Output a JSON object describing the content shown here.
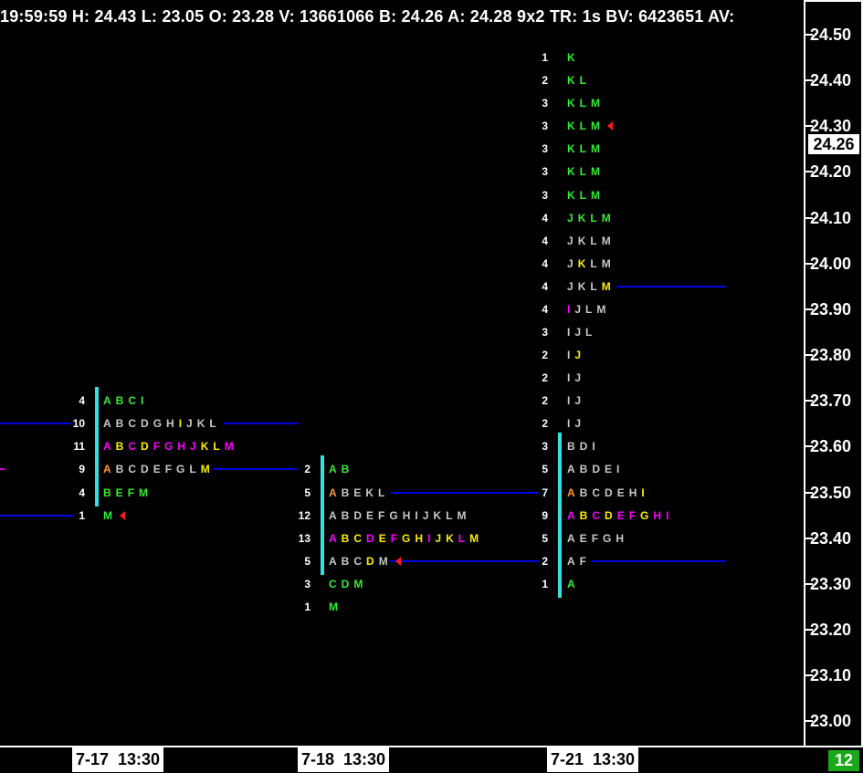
{
  "header": {
    "time": "19:59:59",
    "high_label": "H:",
    "high": "24.43",
    "low_label": "L:",
    "low": "23.05",
    "open_label": "O:",
    "open": "23.28",
    "volume_label": "V:",
    "volume": "13661066",
    "bid_label": "B:",
    "bid": "24.26",
    "ask_label": "A:",
    "ask": "24.28",
    "grid": "9x2",
    "tr_label": "TR:",
    "tr": "1s",
    "bv_label": "BV:",
    "bv": "6423651",
    "av_label": "AV:"
  },
  "colors": {
    "A": "#ff9933",
    "B": "#33ee33",
    "C": "#33ee33",
    "D": "#ffee00",
    "E": "#33ee33",
    "F": "#ff00ff",
    "G": "#ffee00",
    "H": "#ffee00",
    "I": "#ff00ff",
    "J": "#ffee00",
    "K": "#33ee33",
    "L": "#ffee00",
    "M": "#33ee33",
    "gray": "#c8c8c8",
    "value_area": "#33e0e0",
    "poc": "#0000e6",
    "last": "#ff1a1a"
  },
  "price_axis": {
    "labels": [
      "24.50",
      "24.40",
      "24.30",
      "24.20",
      "24.10",
      "24.00",
      "23.90",
      "23.80",
      "23.70",
      "23.60",
      "23.50",
      "23.40",
      "23.30",
      "23.20",
      "23.10",
      "23.00"
    ],
    "current_price": "24.26"
  },
  "profiles": [
    {
      "date_label": "7-17  13:30",
      "rows": [
        {
          "price": 23.7,
          "count": "4",
          "letters": [
            [
              "A",
              "#33ee33"
            ],
            [
              "B",
              "#33ee33"
            ],
            [
              "C",
              "#33ee33"
            ],
            [
              "I",
              "#33ee33"
            ]
          ]
        },
        {
          "price": 23.65,
          "count": "10",
          "letters": [
            [
              "A",
              "#c8c8c8"
            ],
            [
              "B",
              "#c8c8c8"
            ],
            [
              "C",
              "#c8c8c8"
            ],
            [
              "D",
              "#c8c8c8"
            ],
            [
              "G",
              "#c8c8c8"
            ],
            [
              "H",
              "#c8c8c8"
            ],
            [
              "I",
              "#ffee00"
            ],
            [
              "J",
              "#c8c8c8"
            ],
            [
              "K",
              "#c8c8c8"
            ],
            [
              "L",
              "#c8c8c8"
            ]
          ]
        },
        {
          "price": 23.6,
          "count": "11",
          "letters": [
            [
              "A",
              "#ff00ff"
            ],
            [
              "B",
              "#ffee00"
            ],
            [
              "C",
              "#ff00ff"
            ],
            [
              "D",
              "#ffee00"
            ],
            [
              "F",
              "#ff00ff"
            ],
            [
              "G",
              "#ff00ff"
            ],
            [
              "H",
              "#ff00ff"
            ],
            [
              "J",
              "#ff00ff"
            ],
            [
              "K",
              "#ffee00"
            ],
            [
              "L",
              "#ffee00"
            ],
            [
              "M",
              "#ff00ff"
            ]
          ]
        },
        {
          "price": 23.55,
          "count": "9",
          "letters": [
            [
              "A",
              "#ff9933"
            ],
            [
              "B",
              "#c8c8c8"
            ],
            [
              "C",
              "#c8c8c8"
            ],
            [
              "D",
              "#c8c8c8"
            ],
            [
              "E",
              "#c8c8c8"
            ],
            [
              "F",
              "#c8c8c8"
            ],
            [
              "G",
              "#c8c8c8"
            ],
            [
              "L",
              "#c8c8c8"
            ],
            [
              "M",
              "#ffee00"
            ]
          ]
        },
        {
          "price": 23.5,
          "count": "4",
          "letters": [
            [
              "B",
              "#33ee33"
            ],
            [
              "E",
              "#33ee33"
            ],
            [
              "F",
              "#33ee33"
            ],
            [
              "M",
              "#33ee33"
            ]
          ]
        },
        {
          "price": 23.45,
          "count": "1",
          "letters": [
            [
              "M",
              "#33ee33"
            ]
          ],
          "last": true
        }
      ]
    },
    {
      "date_label": "7-18  13:30",
      "rows": [
        {
          "price": 23.55,
          "count": "2",
          "letters": [
            [
              "A",
              "#33ee33"
            ],
            [
              "B",
              "#33ee33"
            ]
          ]
        },
        {
          "price": 23.5,
          "count": "5",
          "letters": [
            [
              "A",
              "#ff9933"
            ],
            [
              "B",
              "#c8c8c8"
            ],
            [
              "E",
              "#c8c8c8"
            ],
            [
              "K",
              "#c8c8c8"
            ],
            [
              "L",
              "#c8c8c8"
            ]
          ]
        },
        {
          "price": 23.45,
          "count": "12",
          "letters": [
            [
              "A",
              "#c8c8c8"
            ],
            [
              "B",
              "#c8c8c8"
            ],
            [
              "D",
              "#c8c8c8"
            ],
            [
              "E",
              "#c8c8c8"
            ],
            [
              "F",
              "#c8c8c8"
            ],
            [
              "G",
              "#c8c8c8"
            ],
            [
              "H",
              "#c8c8c8"
            ],
            [
              "I",
              "#c8c8c8"
            ],
            [
              "J",
              "#c8c8c8"
            ],
            [
              "K",
              "#c8c8c8"
            ],
            [
              "L",
              "#c8c8c8"
            ],
            [
              "M",
              "#c8c8c8"
            ]
          ]
        },
        {
          "price": 23.4,
          "count": "13",
          "letters": [
            [
              "A",
              "#ff00ff"
            ],
            [
              "B",
              "#ffee00"
            ],
            [
              "C",
              "#ffee00"
            ],
            [
              "D",
              "#ff00ff"
            ],
            [
              "E",
              "#ffee00"
            ],
            [
              "F",
              "#ff00ff"
            ],
            [
              "G",
              "#ffee00"
            ],
            [
              "H",
              "#ffee00"
            ],
            [
              "I",
              "#ff00ff"
            ],
            [
              "J",
              "#ffee00"
            ],
            [
              "K",
              "#ffee00"
            ],
            [
              "L",
              "#ff00ff"
            ],
            [
              "M",
              "#ffee00"
            ]
          ]
        },
        {
          "price": 23.35,
          "count": "5",
          "letters": [
            [
              "A",
              "#c8c8c8"
            ],
            [
              "B",
              "#c8c8c8"
            ],
            [
              "C",
              "#c8c8c8"
            ],
            [
              "D",
              "#ffee00"
            ],
            [
              "M",
              "#c8c8c8"
            ]
          ],
          "last": true
        },
        {
          "price": 23.3,
          "count": "3",
          "letters": [
            [
              "C",
              "#33ee33"
            ],
            [
              "D",
              "#33ee33"
            ],
            [
              "M",
              "#33ee33"
            ]
          ]
        },
        {
          "price": 23.25,
          "count": "1",
          "letters": [
            [
              "M",
              "#33ee33"
            ]
          ]
        }
      ]
    },
    {
      "date_label": "7-21  13:30",
      "rows": [
        {
          "price": 24.45,
          "count": "1",
          "letters": [
            [
              "K",
              "#33ee33"
            ]
          ]
        },
        {
          "price": 24.4,
          "count": "2",
          "letters": [
            [
              "K",
              "#33ee33"
            ],
            [
              "L",
              "#33ee33"
            ]
          ]
        },
        {
          "price": 24.35,
          "count": "3",
          "letters": [
            [
              "K",
              "#33ee33"
            ],
            [
              "L",
              "#33ee33"
            ],
            [
              "M",
              "#33ee33"
            ]
          ]
        },
        {
          "price": 24.3,
          "count": "3",
          "letters": [
            [
              "K",
              "#33ee33"
            ],
            [
              "L",
              "#33ee33"
            ],
            [
              "M",
              "#33ee33"
            ]
          ],
          "last": true
        },
        {
          "price": 24.25,
          "count": "3",
          "letters": [
            [
              "K",
              "#33ee33"
            ],
            [
              "L",
              "#33ee33"
            ],
            [
              "M",
              "#33ee33"
            ]
          ]
        },
        {
          "price": 24.2,
          "count": "3",
          "letters": [
            [
              "K",
              "#33ee33"
            ],
            [
              "L",
              "#33ee33"
            ],
            [
              "M",
              "#33ee33"
            ]
          ]
        },
        {
          "price": 24.15,
          "count": "3",
          "letters": [
            [
              "K",
              "#33ee33"
            ],
            [
              "L",
              "#33ee33"
            ],
            [
              "M",
              "#33ee33"
            ]
          ]
        },
        {
          "price": 24.1,
          "count": "4",
          "letters": [
            [
              "J",
              "#33ee33"
            ],
            [
              "K",
              "#33ee33"
            ],
            [
              "L",
              "#33ee33"
            ],
            [
              "M",
              "#33ee33"
            ]
          ]
        },
        {
          "price": 24.05,
          "count": "4",
          "letters": [
            [
              "J",
              "#c8c8c8"
            ],
            [
              "K",
              "#c8c8c8"
            ],
            [
              "L",
              "#c8c8c8"
            ],
            [
              "M",
              "#c8c8c8"
            ]
          ]
        },
        {
          "price": 24.0,
          "count": "4",
          "letters": [
            [
              "J",
              "#c8c8c8"
            ],
            [
              "K",
              "#ffee00"
            ],
            [
              "L",
              "#c8c8c8"
            ],
            [
              "M",
              "#c8c8c8"
            ]
          ]
        },
        {
          "price": 23.95,
          "count": "4",
          "letters": [
            [
              "J",
              "#c8c8c8"
            ],
            [
              "K",
              "#c8c8c8"
            ],
            [
              "L",
              "#c8c8c8"
            ],
            [
              "M",
              "#ffee00"
            ]
          ]
        },
        {
          "price": 23.9,
          "count": "4",
          "letters": [
            [
              "I",
              "#ff00ff"
            ],
            [
              "J",
              "#c8c8c8"
            ],
            [
              "L",
              "#c8c8c8"
            ],
            [
              "M",
              "#c8c8c8"
            ]
          ]
        },
        {
          "price": 23.85,
          "count": "3",
          "letters": [
            [
              "I",
              "#c8c8c8"
            ],
            [
              "J",
              "#c8c8c8"
            ],
            [
              "L",
              "#c8c8c8"
            ]
          ]
        },
        {
          "price": 23.8,
          "count": "2",
          "letters": [
            [
              "I",
              "#c8c8c8"
            ],
            [
              "J",
              "#ffee00"
            ]
          ]
        },
        {
          "price": 23.75,
          "count": "2",
          "letters": [
            [
              "I",
              "#c8c8c8"
            ],
            [
              "J",
              "#c8c8c8"
            ]
          ]
        },
        {
          "price": 23.7,
          "count": "2",
          "letters": [
            [
              "I",
              "#c8c8c8"
            ],
            [
              "J",
              "#c8c8c8"
            ]
          ]
        },
        {
          "price": 23.65,
          "count": "2",
          "letters": [
            [
              "I",
              "#c8c8c8"
            ],
            [
              "J",
              "#c8c8c8"
            ]
          ]
        },
        {
          "price": 23.6,
          "count": "3",
          "letters": [
            [
              "B",
              "#c8c8c8"
            ],
            [
              "D",
              "#c8c8c8"
            ],
            [
              "I",
              "#c8c8c8"
            ]
          ]
        },
        {
          "price": 23.55,
          "count": "5",
          "letters": [
            [
              "A",
              "#c8c8c8"
            ],
            [
              "B",
              "#c8c8c8"
            ],
            [
              "D",
              "#c8c8c8"
            ],
            [
              "E",
              "#c8c8c8"
            ],
            [
              "I",
              "#c8c8c8"
            ]
          ]
        },
        {
          "price": 23.5,
          "count": "7",
          "letters": [
            [
              "A",
              "#ff9933"
            ],
            [
              "B",
              "#c8c8c8"
            ],
            [
              "C",
              "#c8c8c8"
            ],
            [
              "D",
              "#c8c8c8"
            ],
            [
              "E",
              "#c8c8c8"
            ],
            [
              "H",
              "#c8c8c8"
            ],
            [
              "I",
              "#ffee00"
            ]
          ]
        },
        {
          "price": 23.45,
          "count": "9",
          "letters": [
            [
              "A",
              "#ff00ff"
            ],
            [
              "B",
              "#ffee00"
            ],
            [
              "C",
              "#ff00ff"
            ],
            [
              "D",
              "#ffee00"
            ],
            [
              "E",
              "#ff00ff"
            ],
            [
              "F",
              "#ff00ff"
            ],
            [
              "G",
              "#ffee00"
            ],
            [
              "H",
              "#ff00ff"
            ],
            [
              "I",
              "#ff00ff"
            ]
          ]
        },
        {
          "price": 23.4,
          "count": "5",
          "letters": [
            [
              "A",
              "#c8c8c8"
            ],
            [
              "E",
              "#c8c8c8"
            ],
            [
              "F",
              "#c8c8c8"
            ],
            [
              "G",
              "#c8c8c8"
            ],
            [
              "H",
              "#c8c8c8"
            ]
          ]
        },
        {
          "price": 23.35,
          "count": "2",
          "letters": [
            [
              "A",
              "#c8c8c8"
            ],
            [
              "F",
              "#c8c8c8"
            ]
          ]
        },
        {
          "price": 23.3,
          "count": "1",
          "letters": [
            [
              "A",
              "#33ee33"
            ]
          ]
        }
      ]
    }
  ],
  "status_badge": "12"
}
